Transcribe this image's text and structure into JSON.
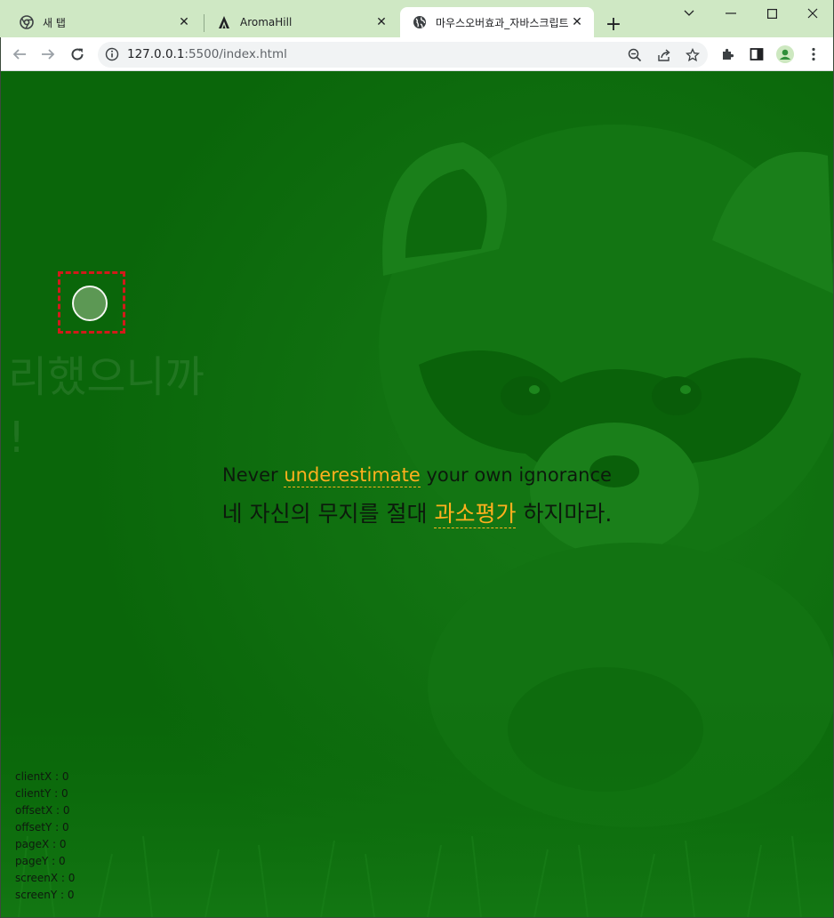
{
  "browser": {
    "tabs": [
      {
        "title": "새 탭",
        "icon": "chrome-icon",
        "active": false
      },
      {
        "title": "AromaHill",
        "icon": "aroma-hill-icon",
        "active": false
      },
      {
        "title": "마우스오버효과_자바스크립트",
        "icon": "globe-icon",
        "active": true
      }
    ],
    "url_host": "127.0.0.1",
    "url_rest": ":5500/index.html"
  },
  "page": {
    "ghost_text": "리했으니까\n!",
    "quote_en": {
      "before": "Never ",
      "highlight": "underestimate",
      "after": " your own ignorance"
    },
    "quote_ko": {
      "before": "네 자신의 무지를 절대 ",
      "highlight": "과소평가",
      "after": " 하지마라."
    },
    "coords": [
      "clientX : 0",
      "clientY : 0",
      "offsetX : 0",
      "offsetY : 0",
      "pageX : 0",
      "pageY : 0",
      "screenX : 0",
      "screenY : 0"
    ]
  },
  "colors": {
    "tabstrip": "#cfe8c4",
    "page_overlay": "#0b6b0b",
    "highlight": "#ffb01e",
    "dash_box": "#d21a1a"
  }
}
